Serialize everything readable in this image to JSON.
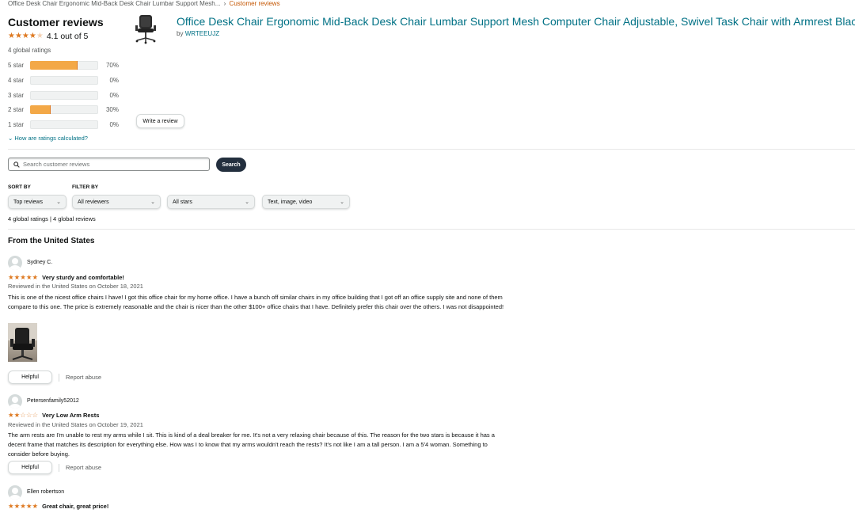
{
  "breadcrumb": {
    "product": "Office Desk Chair Ergonomic Mid-Back Desk Chair Lumbar Support Mesh...",
    "separator": "›",
    "current": "Customer reviews"
  },
  "summary": {
    "title": "Customer reviews",
    "rating_stars": 4.1,
    "rating_text": "4.1 out of 5",
    "global_ratings": "4 global ratings",
    "histogram": [
      {
        "label": "5 star",
        "percent": 70,
        "percent_text": "70%"
      },
      {
        "label": "4 star",
        "percent": 0,
        "percent_text": "0%"
      },
      {
        "label": "3 star",
        "percent": 0,
        "percent_text": "0%"
      },
      {
        "label": "2 star",
        "percent": 30,
        "percent_text": "30%"
      },
      {
        "label": "1 star",
        "percent": 0,
        "percent_text": "0%"
      }
    ],
    "how_calculated": "How are ratings calculated?",
    "write_review": "Write a review"
  },
  "product": {
    "title": "Office Desk Chair Ergonomic Mid-Back Desk Chair Lumbar Support Mesh Computer Chair Adjustable, Swivel Task Chair with Armrest Black",
    "by_prefix": "by",
    "brand": "WRTEEUJZ"
  },
  "search": {
    "placeholder": "Search customer reviews",
    "button": "Search"
  },
  "filters": {
    "sort_caption": "SORT BY",
    "filter_caption": "FILTER BY",
    "sort_value": "Top reviews",
    "reviewers_value": "All reviewers",
    "stars_value": "All stars",
    "media_value": "Text, image, video",
    "counts": "4 global ratings | 4 global reviews"
  },
  "section_title": "From the United States",
  "reviews": [
    {
      "name": "Sydney C.",
      "stars": 5,
      "headline": "Very sturdy and comfortable!",
      "date": "Reviewed in the United States on October 18, 2021",
      "body": "This is one of the nicest office chairs I have! I got this office chair for my home office. I have a bunch off similar chairs in my office building that I got off an office supply site and none of them compare to this one. The price is extremely reasonable and the chair is nicer than the other $100+ office chairs that I have. Definitely prefer this chair over the others. I was not disappointed!",
      "helpful": "Helpful",
      "report": "Report abuse"
    },
    {
      "name": "Petersenfamily52012",
      "stars": 2,
      "headline": "Very Low Arm Rests",
      "date": "Reviewed in the United States on October 19, 2021",
      "body": "The arm rests are I'm unable to rest my arms while I sit. This is kind of a deal breaker for me. It's not a very relaxing chair because of this. The reason for the two stars is because it has a decent frame that matches its description for everything else. How was I to know that my arms wouldn't reach the rests? It's not like I am a tall person. I am a 5'4 woman. Something to consider before buying.",
      "helpful": "Helpful",
      "report": "Report abuse"
    },
    {
      "name": "Ellen robertson",
      "stars": 5,
      "headline": "Great chair, great price!"
    }
  ],
  "colors": {
    "link": "#007185",
    "star": "#de7921",
    "bar_fill": "#f3a847",
    "search_button": "#232f3e"
  }
}
